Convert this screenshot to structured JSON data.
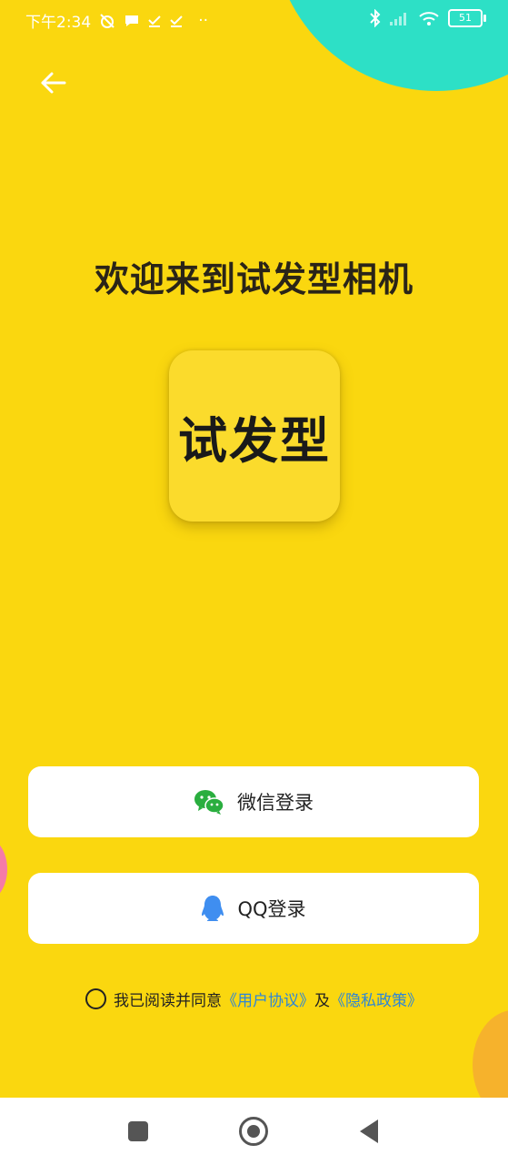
{
  "status_bar": {
    "time": "下午2:34",
    "battery": "51",
    "icons": [
      "alarm-off-icon",
      "message-icon",
      "download-done-icon",
      "download-done-icon",
      "more-dots-icon",
      "bluetooth-icon",
      "signal-icon",
      "wifi-icon",
      "battery-icon"
    ]
  },
  "header": {
    "back_icon": "arrow-left-icon"
  },
  "welcome_title": "欢迎来到试发型相机",
  "logo_text": "试发型",
  "login": {
    "wechat_label": "微信登录",
    "wechat_icon": "wechat-icon",
    "qq_label": "QQ登录",
    "qq_icon": "qq-penguin-icon"
  },
  "agreement": {
    "prefix": "我已阅读并同意",
    "user_agreement": "《用户协议》",
    "conjunction": "及",
    "privacy_policy": "《隐私政策》"
  },
  "colors": {
    "background": "#FAD70F",
    "accent_teal": "#2DE0C6",
    "link": "#2E86D6",
    "wechat_green": "#2AAE3F",
    "qq_blue": "#3F8EF0"
  },
  "nav_bar": {
    "icons": [
      "recents-square-icon",
      "home-circle-icon",
      "back-triangle-icon"
    ]
  }
}
